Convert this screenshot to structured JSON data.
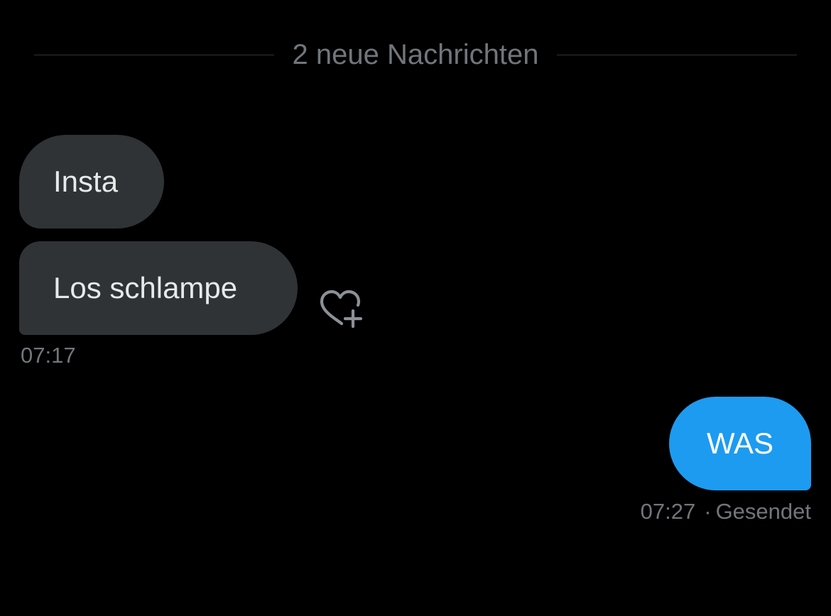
{
  "divider": {
    "label": "2 neue Nachrichten"
  },
  "messages": {
    "incoming": [
      {
        "text": "Insta"
      },
      {
        "text": "Los schlampe"
      }
    ],
    "incoming_time": "07:17",
    "outgoing": [
      {
        "text": "WAS"
      }
    ],
    "outgoing_time": "07:27",
    "outgoing_separator": "·",
    "outgoing_status": "Gesendet"
  },
  "icons": {
    "reaction": "heart-plus-icon"
  },
  "colors": {
    "background": "#000000",
    "incoming_bubble": "#2f3336",
    "outgoing_bubble": "#1d9bf0",
    "muted_text": "#71767b",
    "primary_text": "#e7e9ea"
  }
}
